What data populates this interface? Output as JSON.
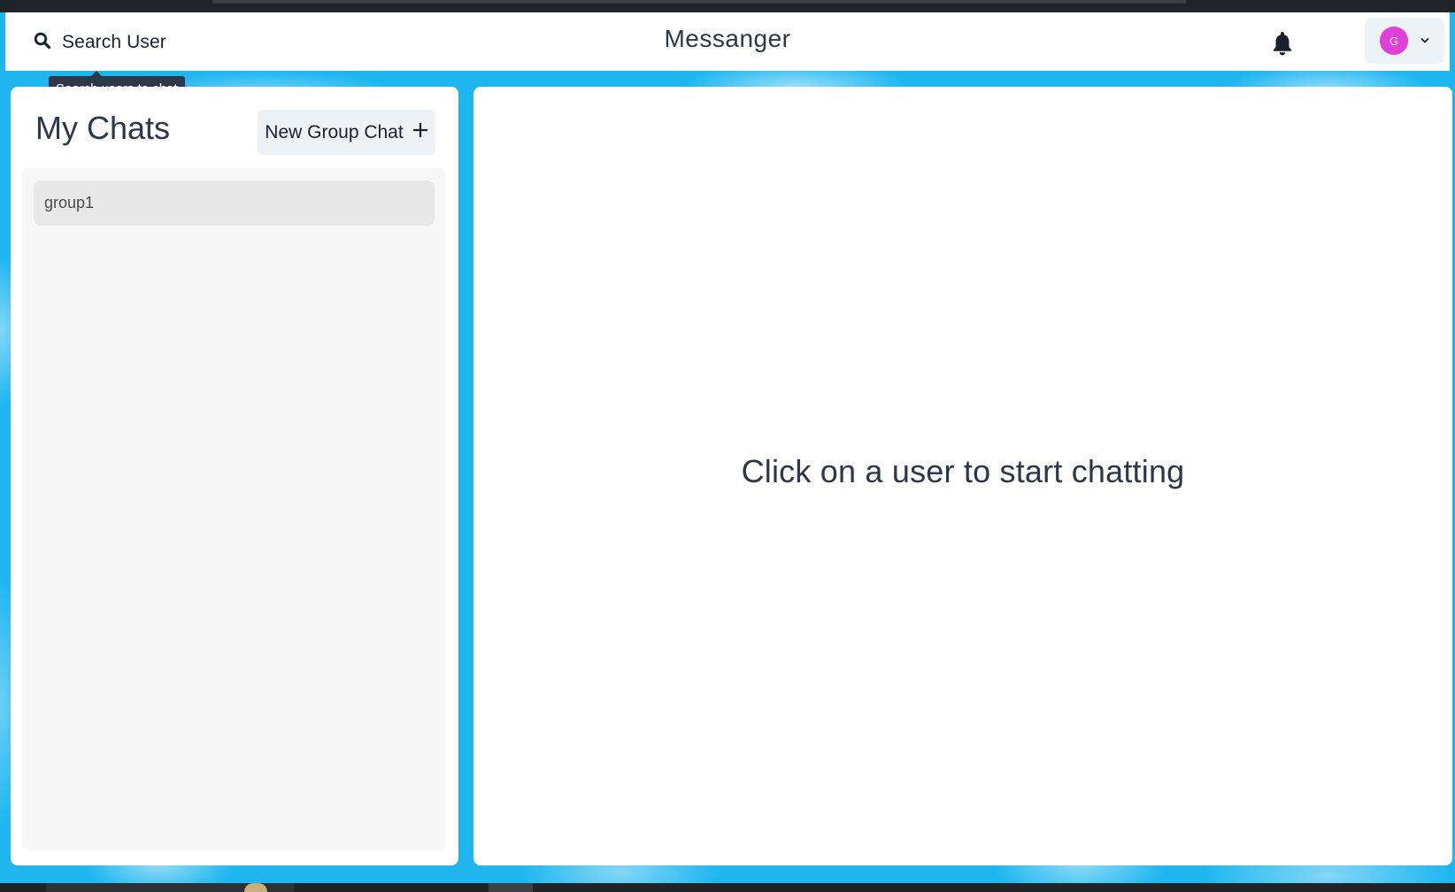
{
  "header": {
    "search_label": "Search User",
    "title": "Messanger",
    "search_icon": "search-icon",
    "bell_icon": "bell-icon",
    "profile": {
      "avatar_initial": "G",
      "avatar_color": "#e03fd8",
      "chevron_icon": "chevron-down-icon"
    }
  },
  "tooltip": {
    "text": "Search users to chat"
  },
  "sidebar": {
    "title": "My Chats",
    "new_group_label": "New Group Chat",
    "plus_icon": "plus-icon",
    "chats": [
      {
        "name": "group1"
      }
    ]
  },
  "main": {
    "empty_message": "Click on a user to start chatting"
  },
  "colors": {
    "background_accent": "#1fb6f0",
    "panel": "#ffffff",
    "button_bg": "#edf2f7",
    "chat_list_bg": "#f7f7f7",
    "chat_item_bg": "#e8e8e8"
  }
}
